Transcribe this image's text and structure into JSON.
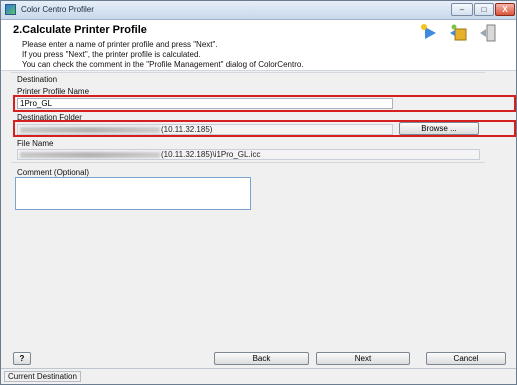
{
  "window": {
    "title": "Color Centro Profiler",
    "minimize": "–",
    "maximize": "□",
    "close": "X"
  },
  "header": {
    "step_title": "2.Calculate Printer Profile",
    "lines": [
      "Please enter a name of printer profile and press \"Next\".",
      "If you press \"Next\", the printer profile is calculated.",
      "You can check the comment in the \"Profile Management\" dialog of ColorCentro."
    ]
  },
  "destination": {
    "group_label": "Destination",
    "profile_name_label": "Printer Profile Name",
    "profile_name_value": "1Pro_GL",
    "folder_label": "Destination Folder",
    "folder_value_suffix": "(10.11.32.185)",
    "browse_label": "Browse ...",
    "file_name_label": "File Name",
    "file_name_suffix": "(10.11.32.185)\\i1Pro_GL.icc"
  },
  "comment": {
    "label": "Comment (Optional)",
    "value": ""
  },
  "footer": {
    "help_label": "?",
    "back_label": "Back",
    "next_label": "Next",
    "cancel_label": "Cancel"
  },
  "statusbar": {
    "text": "Current Destination"
  }
}
